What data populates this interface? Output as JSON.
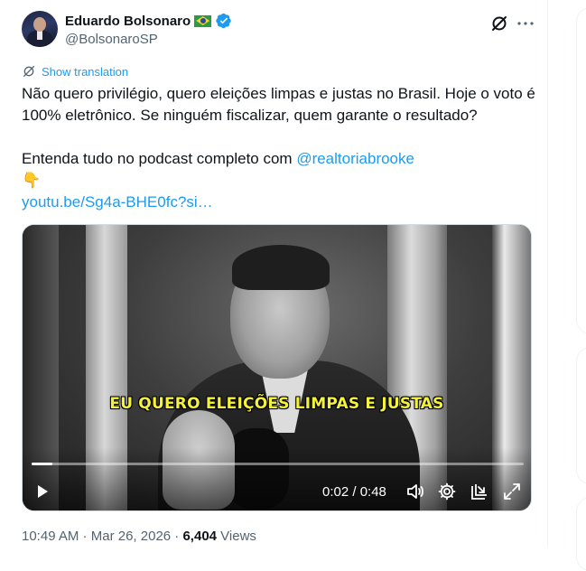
{
  "author": {
    "display_name": "Eduardo Bolsonaro",
    "handle": "@BolsonaroSP",
    "flag_emoji": "brazil-flag",
    "verified_color": "#1d9bf0"
  },
  "actions": {
    "grok_icon": "grok-icon",
    "more_icon": "more-dots-icon"
  },
  "translation": {
    "label": "Show translation"
  },
  "tweet": {
    "line1": "Não quero privilégio, quero eleições limpas e justas no Brasil. Hoje o voto é 100% eletrônico. Se ninguém fiscalizar, quem garante o resultado?",
    "line2_prefix": "Entenda tudo no podcast completo com ",
    "mention": "@realtoriabrooke",
    "pointing_emoji": "👇",
    "url": "youtu.be/Sg4a-BHE0fc?si…"
  },
  "video": {
    "caption": "EU QUERO ELEIÇÕES LIMPAS E JUSTAS",
    "time_display": "0:02 / 0:48",
    "progress_fraction": 0.042,
    "controls": [
      "play-icon",
      "volume-icon",
      "settings-gear-icon",
      "pop-out-icon",
      "fullscreen-icon"
    ]
  },
  "meta": {
    "time": "10:49 AM",
    "separator": " · ",
    "date": "Mar 26, 2026",
    "views_count": "6,404",
    "views_label": " Views"
  },
  "colors": {
    "accent": "#1d9bf0",
    "secondary_text": "#536471",
    "primary_text": "#0f1419",
    "caption_yellow": "#f4f23a"
  }
}
